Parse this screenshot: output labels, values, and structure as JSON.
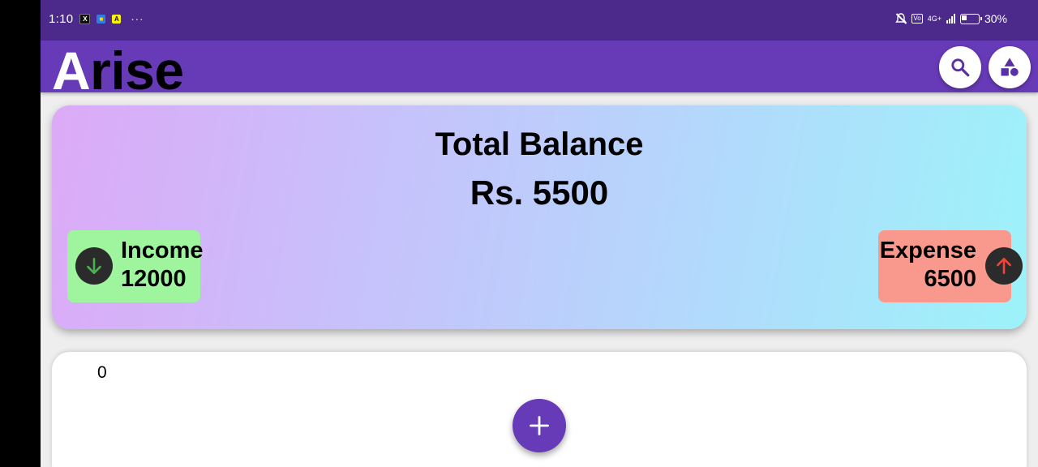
{
  "status_bar": {
    "time": "1:10",
    "notification_icons": [
      "x-app-icon",
      "blue-app-icon",
      "yellow-app-icon"
    ],
    "more": "···",
    "network": "4G+",
    "battery": "30%"
  },
  "app_bar": {
    "title_first": "A",
    "title_rest": "rise",
    "actions": [
      "search-icon",
      "shapes-icon"
    ]
  },
  "balance": {
    "title": "Total Balance",
    "amount": "Rs. 5500",
    "income": {
      "label": "Income",
      "value": "12000",
      "icon": "arrow-down-icon"
    },
    "expense": {
      "label": "Expense",
      "value": "6500",
      "icon": "arrow-up-icon"
    }
  },
  "list": {
    "count": "0"
  },
  "fab": {
    "icon": "plus-icon"
  },
  "colors": {
    "status_bar": "#4b2a8c",
    "app_bar": "#673ab7",
    "income_bg": "#9ef59e",
    "expense_bg": "#f9998e",
    "income_arrow": "#4caf50",
    "expense_arrow": "#f44336",
    "fab": "#673ab7"
  }
}
